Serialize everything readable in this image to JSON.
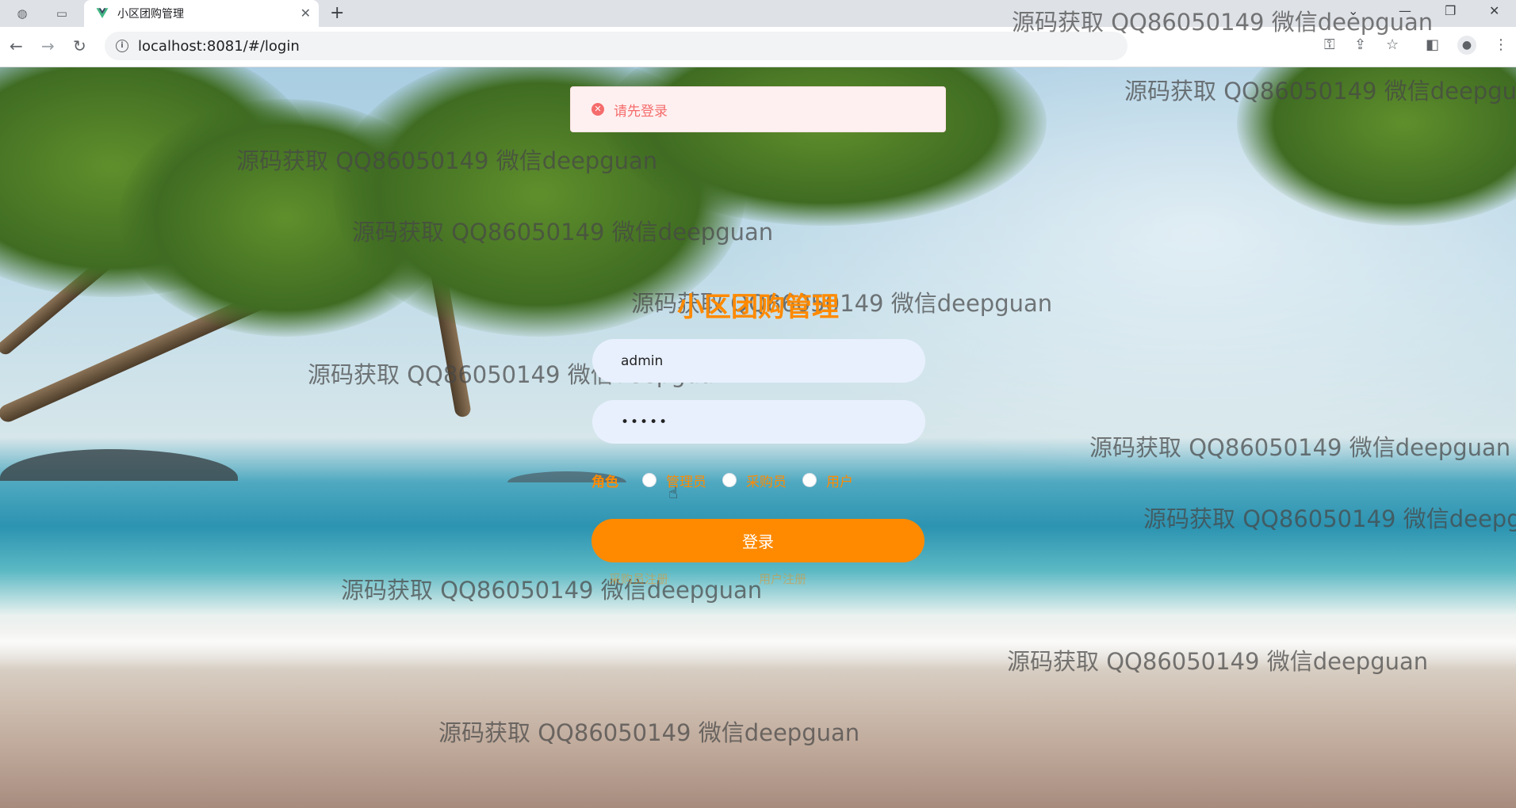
{
  "browser": {
    "tab_title": "小区团购管理",
    "tab_close_icon": "close-icon",
    "new_tab_icon": "plus-icon",
    "url": "localhost:8081/#/login",
    "icons": [
      "globe-icon",
      "page-icon",
      "back-icon",
      "forward-icon",
      "reload-icon",
      "info-icon",
      "key-icon",
      "share-icon",
      "star-icon",
      "sidebar-icon",
      "profile-icon",
      "menu-icon"
    ]
  },
  "toast": {
    "message": "请先登录",
    "icon": "error-circle-icon",
    "color": "#f56c6c"
  },
  "login": {
    "title": "小区团购管理",
    "username_value": "admin",
    "password_value": "•••••",
    "role_label": "角色",
    "roles": [
      "管理员",
      "采购员",
      "用户"
    ],
    "submit_label": "登录",
    "register_links": [
      "采购员注册",
      "用户注册"
    ],
    "accent_color": "#ff8a00"
  },
  "watermark": {
    "text": "源码获取 QQ86050149 微信deepguan"
  }
}
